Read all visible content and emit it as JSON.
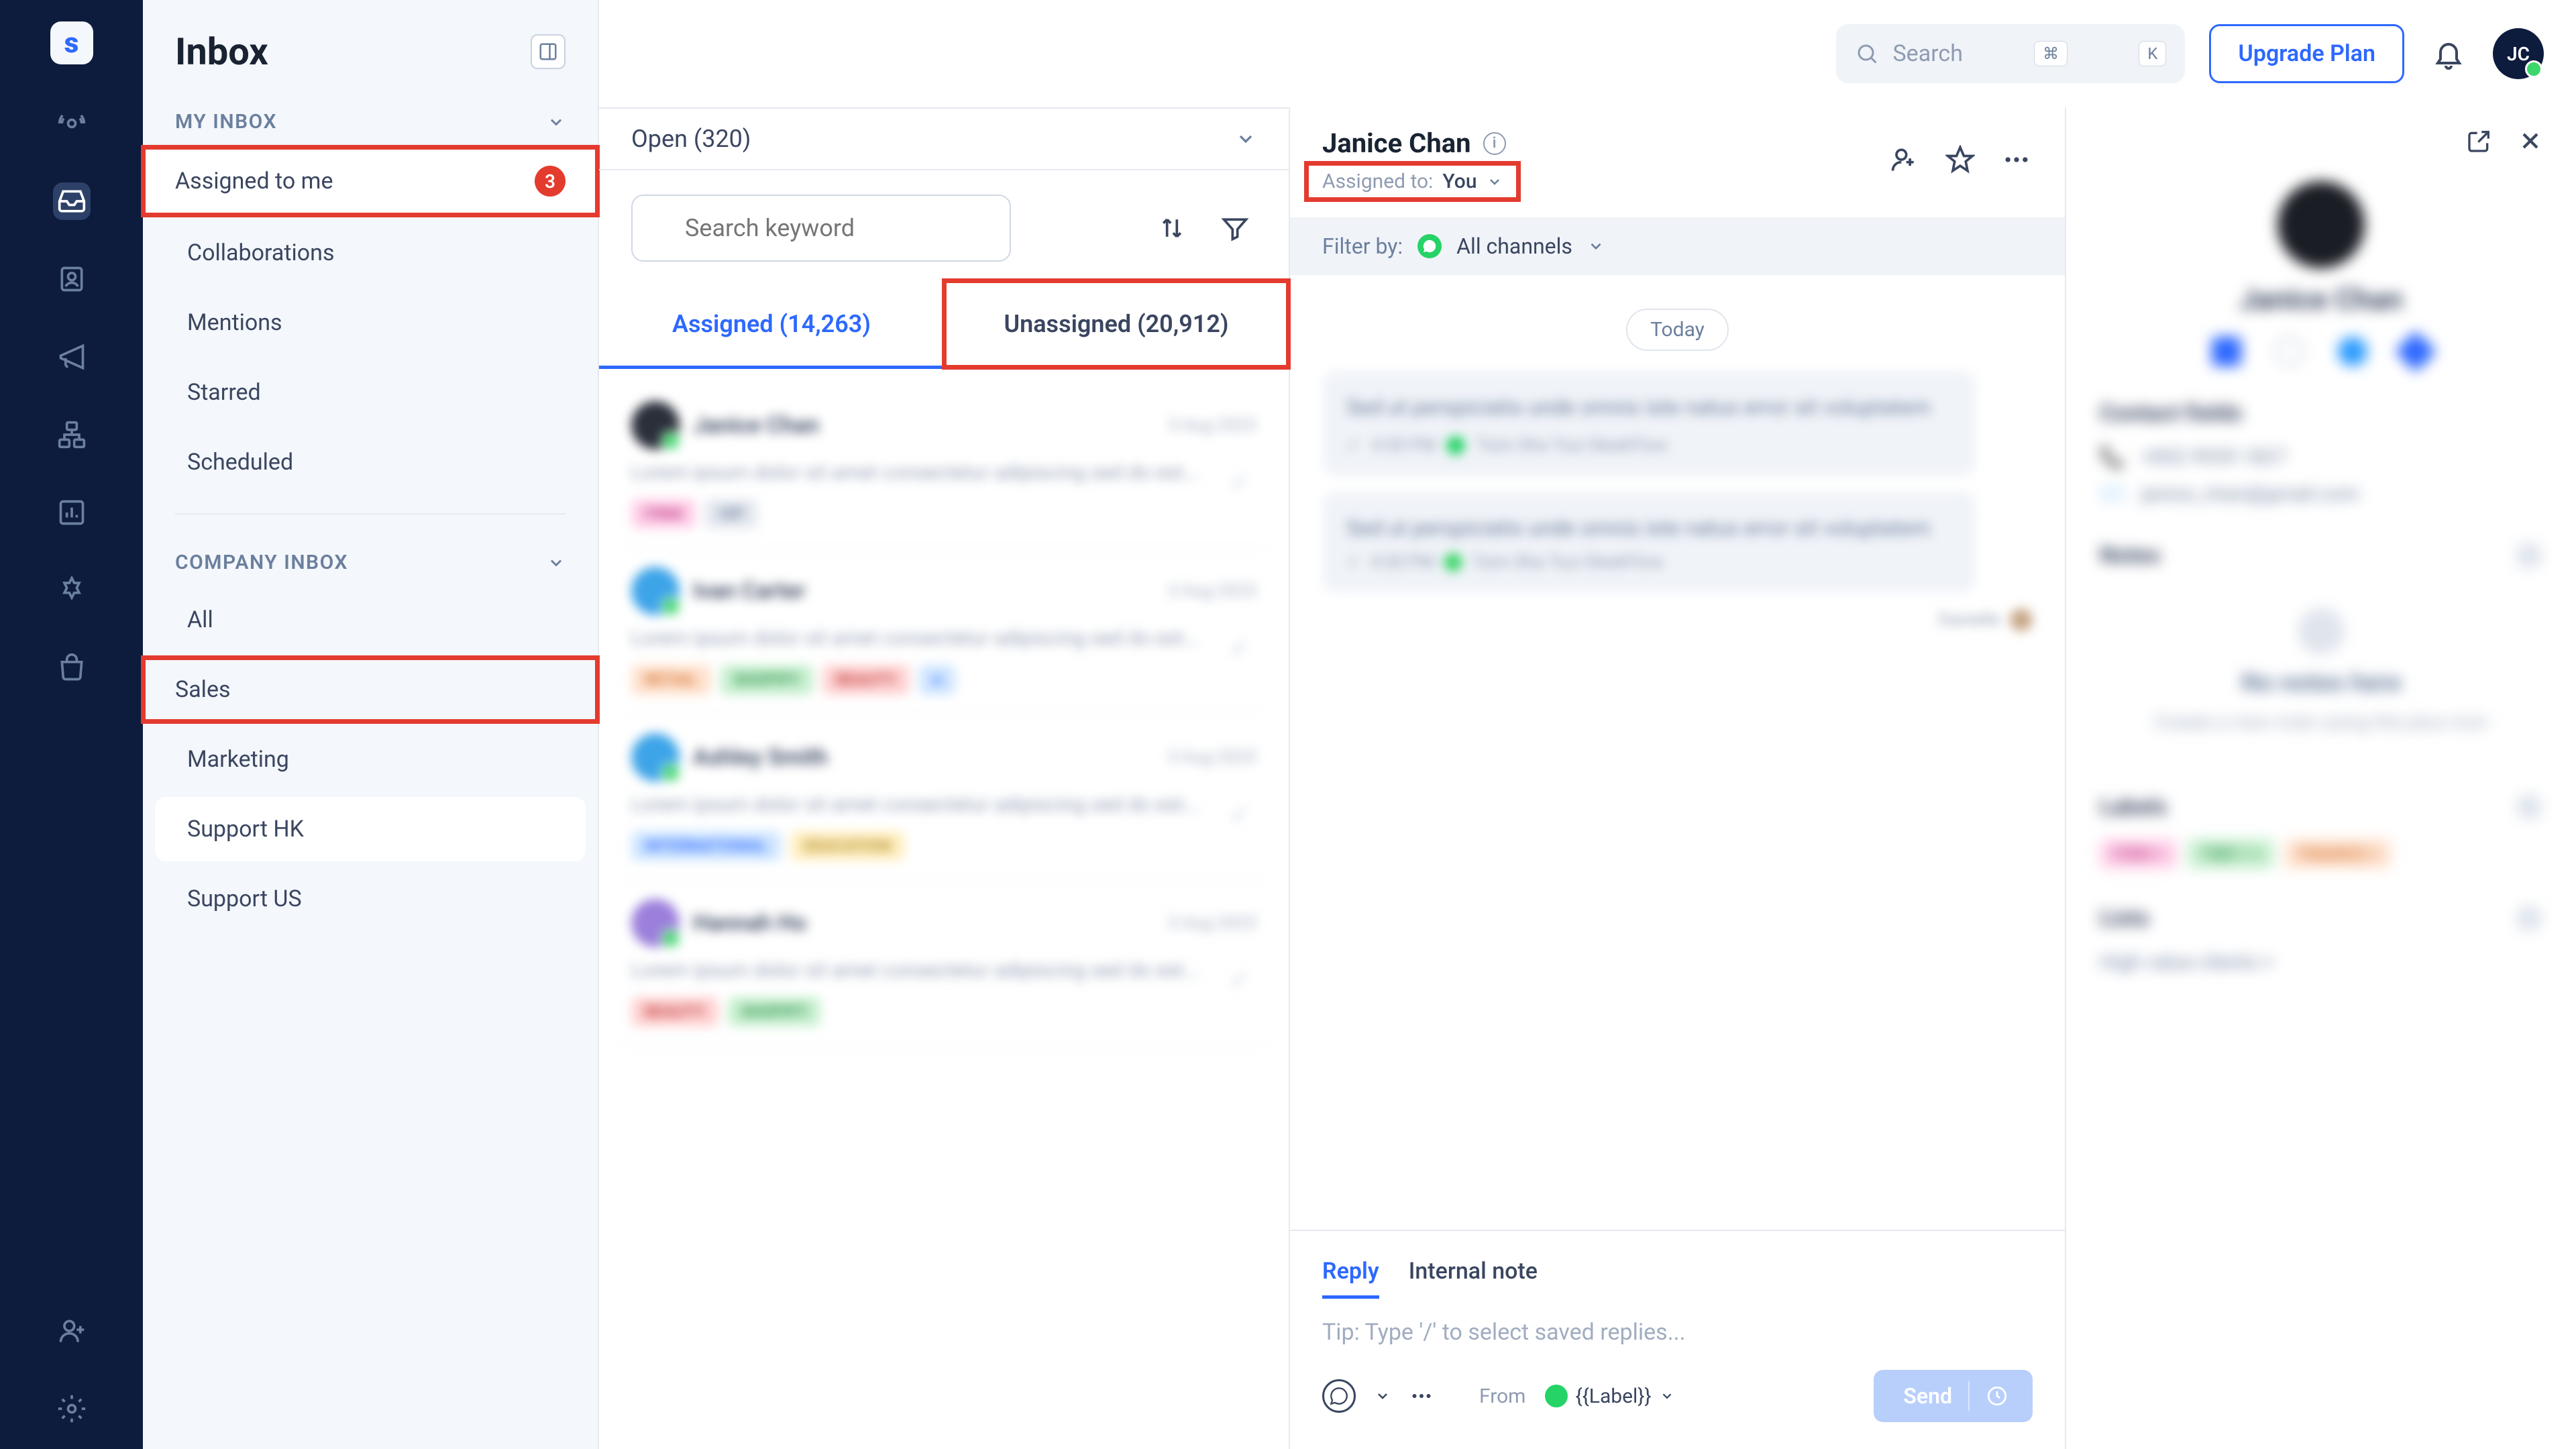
{
  "rail": {
    "logo": "s"
  },
  "sidebar": {
    "title": "Inbox",
    "my_inbox": {
      "header": "MY INBOX",
      "items": [
        {
          "label": "Assigned to me",
          "badge": "3"
        },
        {
          "label": "Collaborations"
        },
        {
          "label": "Mentions"
        },
        {
          "label": "Starred"
        },
        {
          "label": "Scheduled"
        }
      ]
    },
    "company_inbox": {
      "header": "COMPANY INBOX",
      "items": [
        {
          "label": "All"
        },
        {
          "label": "Sales"
        },
        {
          "label": "Marketing"
        },
        {
          "label": "Support HK"
        },
        {
          "label": "Support US"
        }
      ]
    }
  },
  "topbar": {
    "search_placeholder": "Search",
    "kb_cmd": "⌘",
    "kb_k": "K",
    "upgrade": "Upgrade Plan",
    "avatar": "JC"
  },
  "listcol": {
    "open_label": "Open (320)",
    "search_placeholder": "Search keyword",
    "tabs": {
      "assigned": "Assigned (14,263)",
      "unassigned": "Unassigned (20,912)"
    },
    "conversations": [
      {
        "name": "Janice Chan",
        "date": "3 Aug 2023",
        "text": "Lorem ipsum dolor sit amet consectetur adipiscing sed do est...",
        "tags": [
          "FIRM",
          "VIP"
        ]
      },
      {
        "name": "Ivan Carter",
        "date": "3 Aug 2023",
        "text": "Lorem ipsum dolor sit amet consectetur adipiscing sed do est...",
        "tags": [
          "RETAIL",
          "SHOPIFY",
          "BEAUTY"
        ]
      },
      {
        "name": "Ashley Smith",
        "date": "3 Aug 2023",
        "text": "Lorem ipsum dolor sit amet consectetur adipiscing sed do est...",
        "tags": [
          "INTERNATIONAL",
          "EDUCATION"
        ]
      },
      {
        "name": "Hannah Ho",
        "date": "3 Aug 2023",
        "text": "Lorem ipsum dolor sit amet consectetur adipiscing sed do est...",
        "tags": [
          "BEAUTY",
          "SHOPIFY"
        ]
      }
    ]
  },
  "conversation": {
    "name": "Janice Chan",
    "assigned_label": "Assigned to:",
    "assigned_value": "You",
    "filter_label": "Filter by:",
    "filter_value": "All channels",
    "date_label": "Today",
    "messages": [
      {
        "text": "Sed ut perspiciatis unde omnis iste natus error sit voluptatem",
        "time": "4:30 PM",
        "channel": "Tsim Sha Tsui SleekFlow"
      },
      {
        "text": "Sed ut perspiciatis unde omnis iste natus error sit voluptatem",
        "time": "4:30 PM",
        "channel": "Tsim Sha Tsui SleekFlow"
      }
    ],
    "footer_name": "Danielle",
    "reply_tab": "Reply",
    "note_tab": "Internal note",
    "reply_hint": "Tip: Type '/' to select saved replies...",
    "from_label": "From",
    "label_chip": "{{Label}}",
    "send": "Send"
  },
  "details": {
    "name": "Janice Chan",
    "contact_fields_header": "Contact fields",
    "phone": "+852 9939 1827",
    "email": "janice_chan@gmail.com",
    "notes_header": "Notes",
    "no_notes_title": "No notes here",
    "no_notes_sub": "Create a new note using the plus icon",
    "labels_header": "Labels",
    "labels": [
      "FIRM ×",
      "TIER 1 ×",
      "FINANCE ×"
    ],
    "lists_header": "Lists",
    "lists_text": "High value clients ×"
  }
}
